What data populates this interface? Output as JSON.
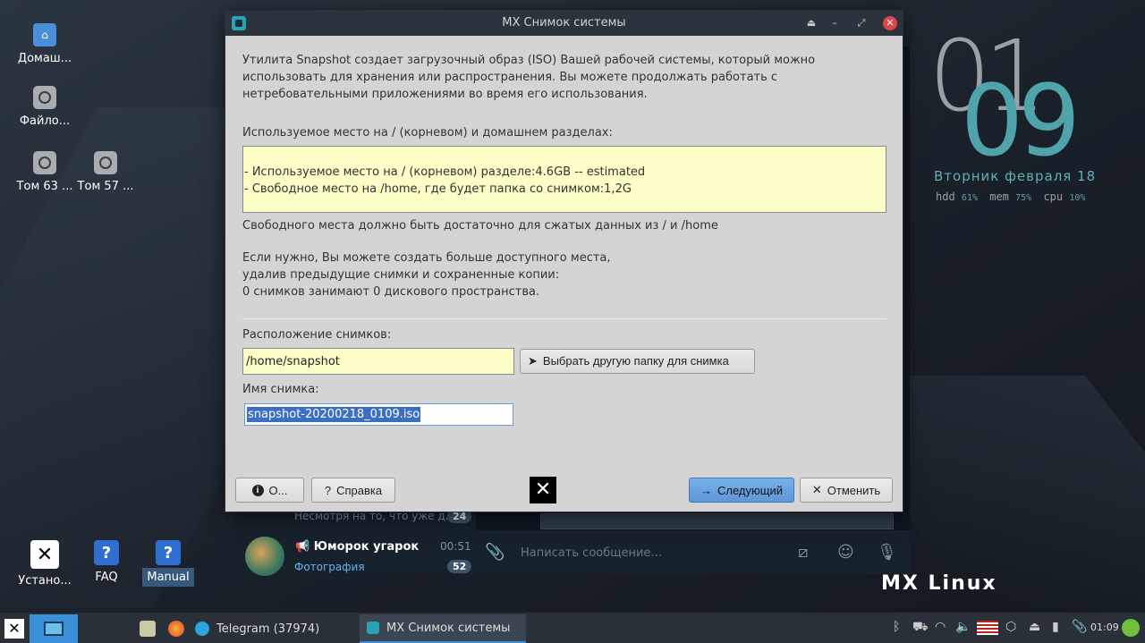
{
  "desktop": {
    "icons": [
      {
        "label": "Домаш..."
      },
      {
        "label": "Файло..."
      },
      {
        "label": "Том 63 ..."
      },
      {
        "label": "Том 57 ..."
      },
      {
        "label": "Устано..."
      },
      {
        "label": "FAQ"
      },
      {
        "label": "Manual"
      }
    ]
  },
  "clock": {
    "hours": "01",
    "minutes": "09",
    "date": "Вторник  февраля 18",
    "hdd_label": "hdd",
    "hdd_value": "61%",
    "mem_label": "mem",
    "mem_value": "75%",
    "cpu_label": "cpu",
    "cpu_value": "10%"
  },
  "brand": {
    "logo_text": "MX Linux"
  },
  "telegram": {
    "prev_text": "Несмотря на то, что уже д...",
    "prev_badge": "24",
    "chat_name": "Юморок угарок",
    "chat_time": "00:51",
    "chat_sub": "Фотография",
    "chat_badge": "52",
    "input_placeholder": "Написать сообщение..."
  },
  "dialog": {
    "title": "MX Снимок системы",
    "intro": "Утилита Snapshot создает загрузочный образ (ISO) Вашей рабочей системы, который можно использовать для хранения или распространения. Вы можете продолжать работать с нетребовательными приложениями во время его использования.",
    "usage_label": "Используемое место на / (корневом) и домашнем разделах:",
    "usage_line1": "- Используемое место на / (корневом) разделе:4.6GB -- estimated",
    "usage_line2": "- Свободное место на /home, где будет папка со снимком:1,2G",
    "enough_text": "Свободного места должно быть достаточно для сжатых данных из / и /home",
    "advice_line1": "Если нужно, Вы можете создать больше доступного места,",
    "advice_line2": "удалив предыдущие снимки и сохраненные копии:",
    "advice_line3": "0 снимков занимают 0 дискового пространства.",
    "location_label": "Расположение снимков:",
    "location_value": "/home/snapshot",
    "choose_button": "Выбрать другую папку для снимка",
    "name_label": "Имя снимка:",
    "name_value": "snapshot-20200218_0109.iso",
    "about_button": "О...",
    "help_button": "Справка",
    "next_button": "Следующий",
    "cancel_button": "Отменить"
  },
  "taskbar": {
    "telegram_task": "Telegram (37974)",
    "snapshot_task": "MX Снимок системы",
    "time": "01:09"
  },
  "colors": {
    "dialog_bg": "#d4d4d4",
    "highlight_field": "#fdfdc8",
    "accent": "#3a8fd9",
    "clock_teal": "#4fa3aa"
  }
}
